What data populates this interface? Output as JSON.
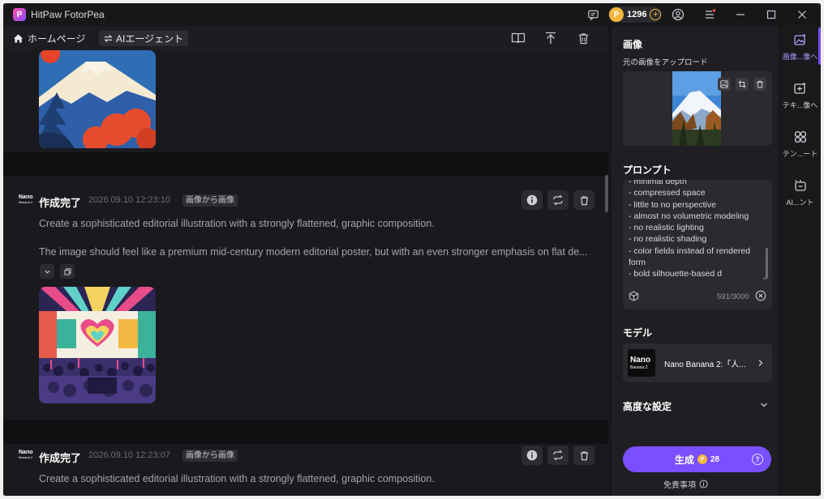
{
  "app": {
    "title": "HitPaw FotorPea",
    "credits": "1296"
  },
  "colors": {
    "accent": "#7a4fff",
    "coin": "#f3b73a",
    "bg": "#111114"
  },
  "header": {
    "home_label": "ホームページ",
    "agent_label": "AIエージェント"
  },
  "cards": [
    {
      "model_badge": "Nano",
      "model_badge_sub": "Banana 2",
      "title": "作成完了",
      "time": "2026.09.10  12:23:10",
      "tag": "画像から画像",
      "text1": "Create a sophisticated editorial illustration with a strongly flattened, graphic composition.",
      "text2": "The image should feel like a premium mid-century modern editorial poster, but with an even stronger emphasis on flat de..."
    },
    {
      "model_badge": "Nano",
      "model_badge_sub": "Banana 2",
      "title": "作成完了",
      "time": "2026.09.10  12:23:07",
      "tag": "画像から画像",
      "text1": "Create a sophisticated editorial illustration with a strongly flattened, graphic composition."
    }
  ],
  "panel": {
    "image_heading": "画像",
    "upload_label": "元の画像をアップロード",
    "prompt_heading": "プロンプト",
    "prompt_lines": [
      "- minimal depth",
      "- compressed space",
      "- little to no perspective",
      "- almost no volumetric modeling",
      "- no realistic lighting",
      "- no realistic shading",
      "- color fields instead of rendered form",
      "- bold silhouette-based d"
    ],
    "prompt_count": "591/3000",
    "model_heading": "モデル",
    "model_thumb_main": "Nano",
    "model_thumb_sub": "Banana 2",
    "model_name": "Nano Banana 2:「人...",
    "advanced_heading": "高度な設定",
    "generate_label": "生成",
    "generate_cost": "28",
    "disclaimer": "免責事項"
  },
  "sidenav": [
    {
      "label": "画像...像へ",
      "icon": "image-to-image-icon",
      "active": true
    },
    {
      "label": "テキ...像へ",
      "icon": "text-to-image-icon",
      "active": false
    },
    {
      "label": "テン...ート",
      "icon": "template-icon",
      "active": false
    },
    {
      "label": "AI...ント",
      "icon": "ai-agent-icon",
      "active": false
    }
  ]
}
